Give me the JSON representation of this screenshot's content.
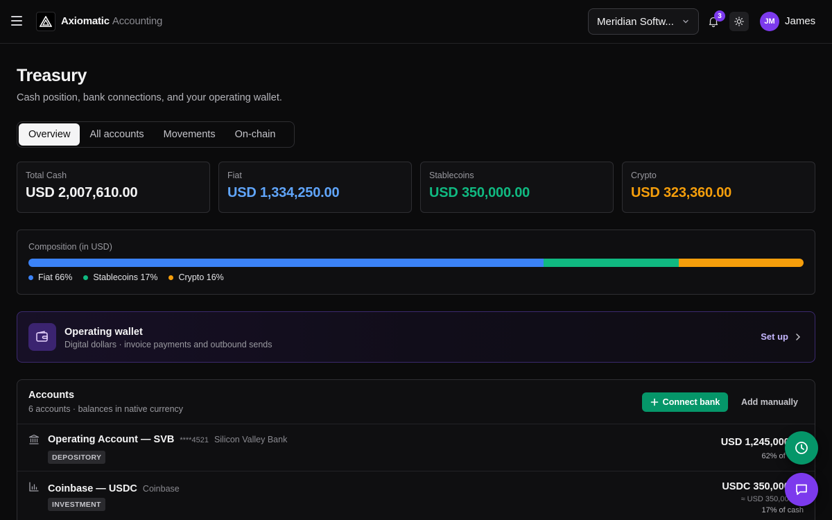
{
  "colors": {
    "accent": "#7c3aed",
    "fiat": "#3b82f6",
    "stablecoins": "#10b981",
    "crypto": "#f59e0b",
    "success": "#059669"
  },
  "header": {
    "brand_bold": "Axiomatic",
    "brand_light": "Accounting",
    "org_select": "Meridian Softw...",
    "notifications_count": "3",
    "user_initials": "JM",
    "user_name": "James"
  },
  "page": {
    "title": "Treasury",
    "subtitle": "Cash position, bank connections, and your operating wallet."
  },
  "tabs": [
    {
      "label": "Overview",
      "active": true
    },
    {
      "label": "All accounts",
      "active": false
    },
    {
      "label": "Movements",
      "active": false
    },
    {
      "label": "On-chain",
      "active": false
    }
  ],
  "stats": [
    {
      "label": "Total Cash",
      "value": "USD 2,007,610.00",
      "color": "#f4f4f5"
    },
    {
      "label": "Fiat",
      "value": "USD 1,334,250.00",
      "color": "#60a5fa"
    },
    {
      "label": "Stablecoins",
      "value": "USD 350,000.00",
      "color": "#10b981"
    },
    {
      "label": "Crypto",
      "value": "USD 323,360.00",
      "color": "#f59e0b"
    }
  ],
  "composition": {
    "label": "Composition (in USD)",
    "segments": [
      {
        "label": "Fiat 66%",
        "percent": 66.46,
        "color": "#3b82f6"
      },
      {
        "label": "Stablecoins 17%",
        "percent": 17.43,
        "color": "#10b981"
      },
      {
        "label": "Crypto 16%",
        "percent": 16.11,
        "color": "#f59e0b"
      }
    ]
  },
  "wallet": {
    "title": "Operating wallet",
    "subtitle": "Digital dollars · invoice payments and outbound sends",
    "action": "Set up"
  },
  "accounts": {
    "title": "Accounts",
    "subtitle": "6 accounts · balances in native currency",
    "connect_label": "Connect bank",
    "manual_label": "Add manually",
    "rows": [
      {
        "name": "Operating Account — SVB",
        "mask": "****4521",
        "bank": "Silicon Valley Bank",
        "tag": "DEPOSITORY",
        "icon": "bank-icon",
        "amount": "USD 1,245,000.00",
        "approx": "",
        "pct": "62% of cash"
      },
      {
        "name": "Coinbase — USDC",
        "mask": "",
        "bank": "Coinbase",
        "tag": "INVESTMENT",
        "icon": "chart-icon",
        "amount": "USDC 350,000.00",
        "approx": "≈ USD 350,000.00",
        "pct": "17% of cash"
      }
    ]
  },
  "floating": {
    "clock": "clock-icon",
    "chat": "chat-icon"
  }
}
